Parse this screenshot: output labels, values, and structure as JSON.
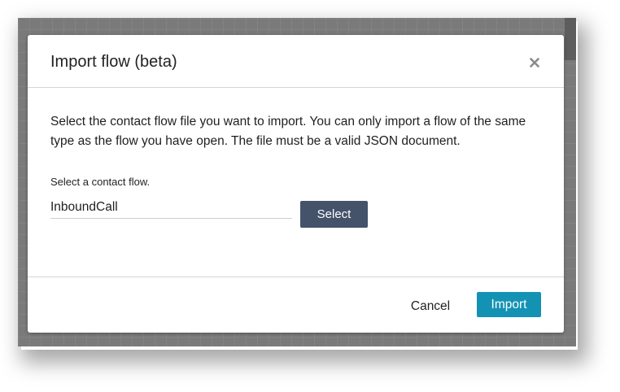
{
  "modal": {
    "title": "Import flow (beta)",
    "close_icon": "close-icon",
    "description": "Select the contact flow file you want to import. You can only import a flow of the same type as the flow you have open. The file must be a valid JSON document.",
    "field_label": "Select a contact flow.",
    "file_value": "InboundCall",
    "select_label": "Select",
    "cancel_label": "Cancel",
    "import_label": "Import"
  },
  "colors": {
    "select_button": "#44536a",
    "import_button": "#1492b4",
    "backdrop": "#7a7a7a"
  }
}
